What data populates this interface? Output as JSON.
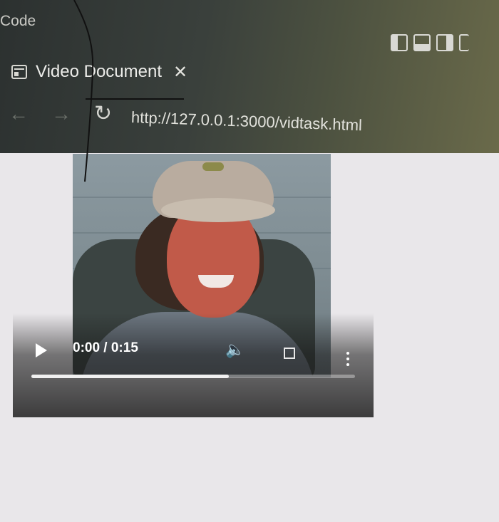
{
  "app": {
    "title": "Code"
  },
  "layout_controls": [
    {
      "name": "toggle-primary-sidebar"
    },
    {
      "name": "toggle-panel"
    },
    {
      "name": "toggle-secondary-sidebar"
    },
    {
      "name": "customize-layout"
    }
  ],
  "tab": {
    "icon": "preview-icon",
    "label": "Video Document",
    "close_glyph": "✕"
  },
  "nav": {
    "back_glyph": "←",
    "forward_glyph": "→",
    "reload_glyph": "↻",
    "url": "http://127.0.0.1:3000/vidtask.html"
  },
  "video": {
    "time_display": "0:00 / 0:15",
    "current_time": "0:00",
    "duration": "0:15",
    "progress_fraction": 0.61,
    "icons": [
      "play-icon",
      "volume-icon",
      "fullscreen-icon",
      "more-options-icon"
    ]
  }
}
